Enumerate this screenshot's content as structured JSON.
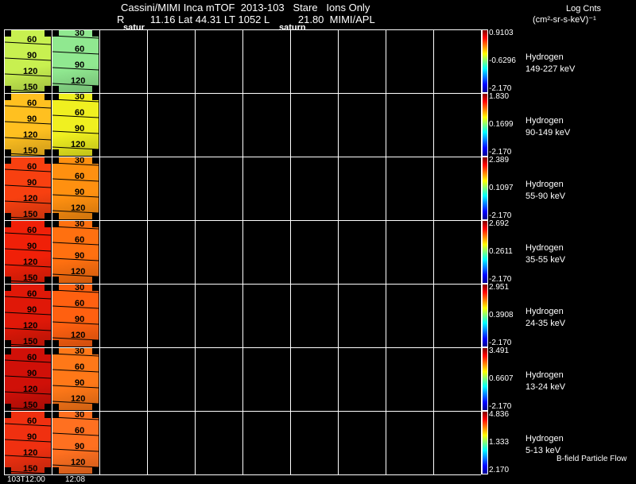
{
  "header": {
    "title": "Cassini/MIMI Inca mTOF  2013-103   Stare   Ions Only",
    "subtitle": "R         11.16 Lat 44.31 LT 1052 L          21.80  MIMI/APL",
    "label_left": "satur",
    "label_right": "saturn"
  },
  "units": {
    "line1": "Log Cnts",
    "line2": "(cm²-sr-s-keV)⁻¹"
  },
  "panels": [
    {
      "species": "Hydrogen",
      "energy": "149-227 keV",
      "max": "0.9103",
      "mid": "-0.6296",
      "min": "-2.170",
      "left_color": "#c8f050",
      "right_color": "#90e890"
    },
    {
      "species": "Hydrogen",
      "energy": "90-149 keV",
      "max": "1.830",
      "mid": "0.1699",
      "min": "-2.170",
      "left_color": "#ffc020",
      "right_color": "#f0f020"
    },
    {
      "species": "Hydrogen",
      "energy": "55-90 keV",
      "max": "2.389",
      "mid": "0.1097",
      "min": "-2.170",
      "left_color": "#f84010",
      "right_color": "#ff9010"
    },
    {
      "species": "Hydrogen",
      "energy": "35-55 keV",
      "max": "2.692",
      "mid": "0.2611",
      "min": "-2.170",
      "left_color": "#f02008",
      "right_color": "#ff7010"
    },
    {
      "species": "Hydrogen",
      "energy": "24-35 keV",
      "max": "2.951",
      "mid": "0.3908",
      "min": "-2.170",
      "left_color": "#e01808",
      "right_color": "#ff6010"
    },
    {
      "species": "Hydrogen",
      "energy": "13-24 keV",
      "max": "3.491",
      "mid": "0.6607",
      "min": "-2.170",
      "left_color": "#d01008",
      "right_color": "#ff7818"
    },
    {
      "species": "Hydrogen",
      "energy": "5-13 keV",
      "max": "4.836",
      "mid": "1.333",
      "min": "2.170",
      "left_color": "#f03010",
      "right_color": "#ff7020"
    }
  ],
  "image_labels": {
    "left": [
      "60",
      "90",
      "120",
      "150"
    ],
    "right": [
      "30",
      "60",
      "90",
      "120"
    ]
  },
  "footer": {
    "time_start": "103T12:00",
    "time_next": "12:08",
    "bfield_label": "B-field Particle Flow"
  }
}
